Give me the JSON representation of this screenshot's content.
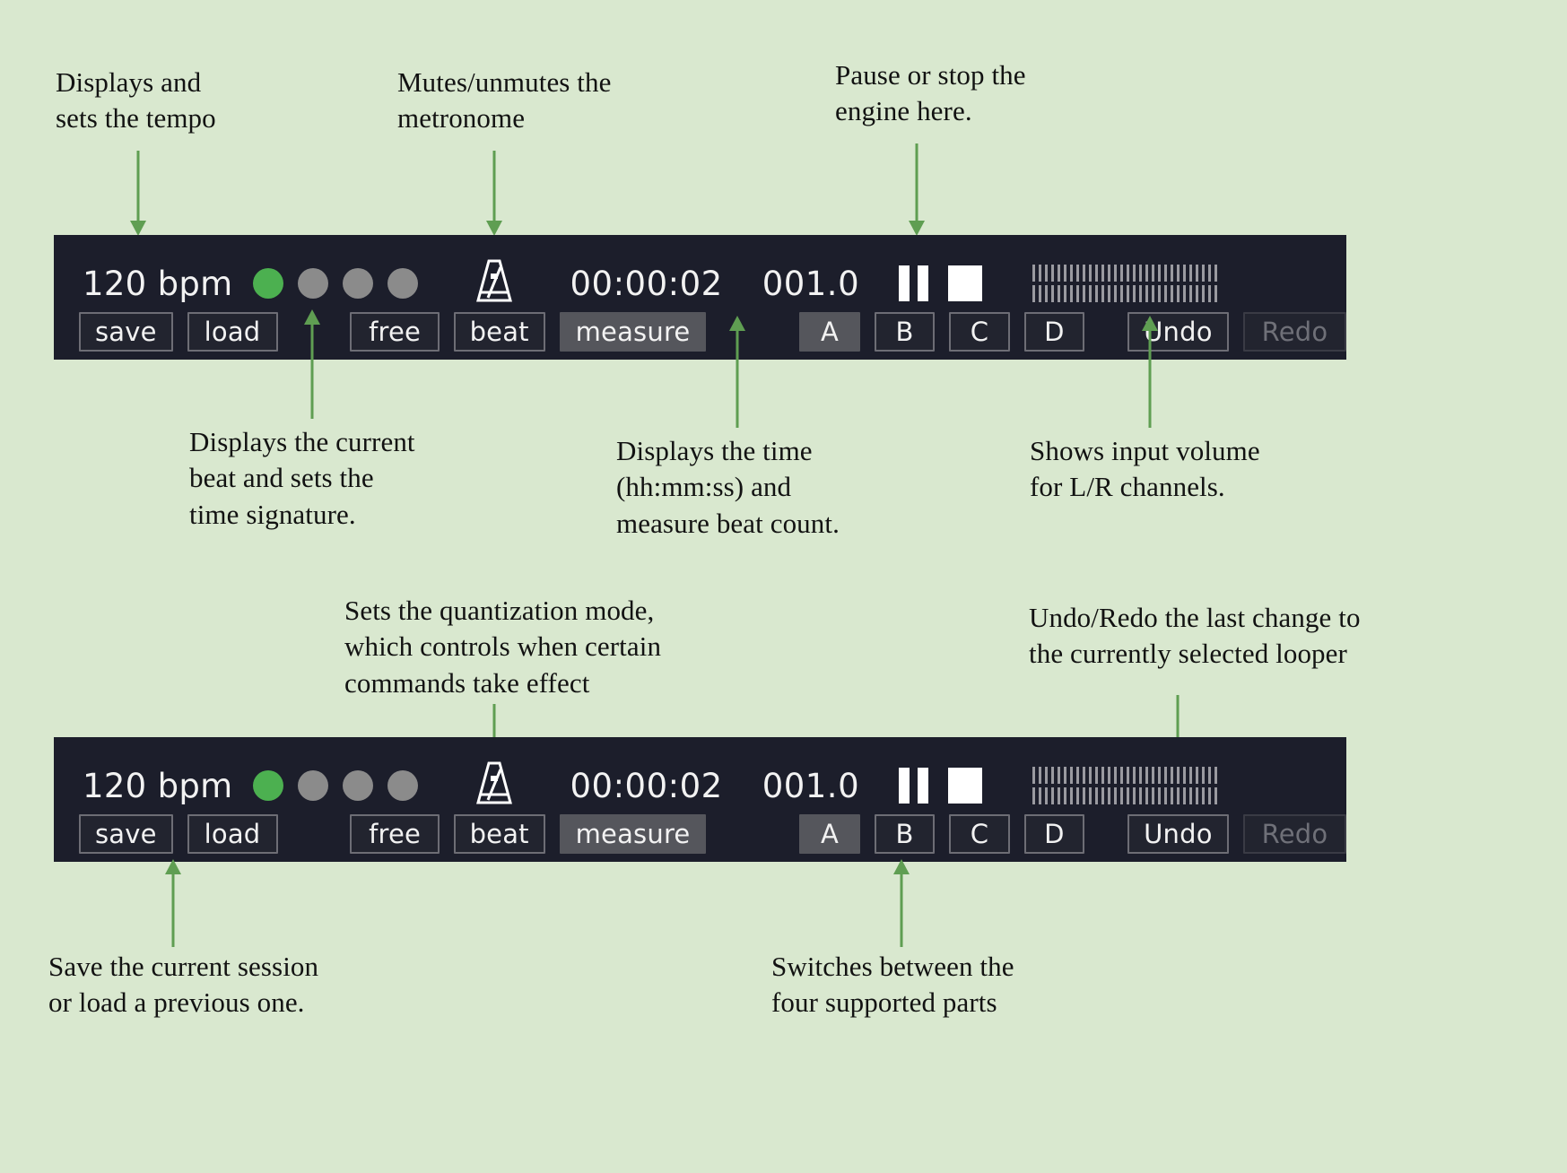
{
  "page": {
    "background_color": "#d9e8cf",
    "accent_color": "#5f9e52",
    "toolbar_color": "#1c1e2b"
  },
  "toolbar": {
    "bpm": "120 bpm",
    "beat_leds": [
      {
        "state": "on",
        "color": "#4cb050"
      },
      {
        "state": "off",
        "color": "#8b8b8b"
      },
      {
        "state": "off",
        "color": "#8b8b8b"
      },
      {
        "state": "off",
        "color": "#8b8b8b"
      }
    ],
    "metronome_icon": "metronome-icon",
    "time": "00:00:02",
    "measure_count": "001.0",
    "pause_icon": "pause-icon",
    "stop_icon": "stop-icon",
    "meter_label": "input-level-meter",
    "meter_ticks": 30,
    "buttons": {
      "save": "save",
      "load": "load",
      "free": "free",
      "beat": "beat",
      "measure": "measure",
      "part_a": "A",
      "part_b": "B",
      "part_c": "C",
      "part_d": "D",
      "undo": "Undo",
      "redo": "Redo"
    },
    "active_quantize": "measure",
    "active_part": "A",
    "redo_disabled": true
  },
  "annotations": {
    "tempo": "Displays and\nsets the tempo",
    "metronome": "Mutes/unmutes the\nmetronome",
    "transport": "Pause or stop the\nengine here.",
    "beat": "Displays the current\nbeat and sets the\ntime signature.",
    "time": "Displays the time\n(hh:mm:ss) and\nmeasure beat count.",
    "meter": "Shows input volume\nfor L/R channels.",
    "quantize": "Sets the quantization mode,\nwhich controls when certain\ncommands take effect",
    "undoredo": "Undo/Redo the last change to\nthe currently selected looper",
    "saveload": "Save the current session\nor load a previous one.",
    "parts": "Switches between the\nfour supported parts"
  }
}
